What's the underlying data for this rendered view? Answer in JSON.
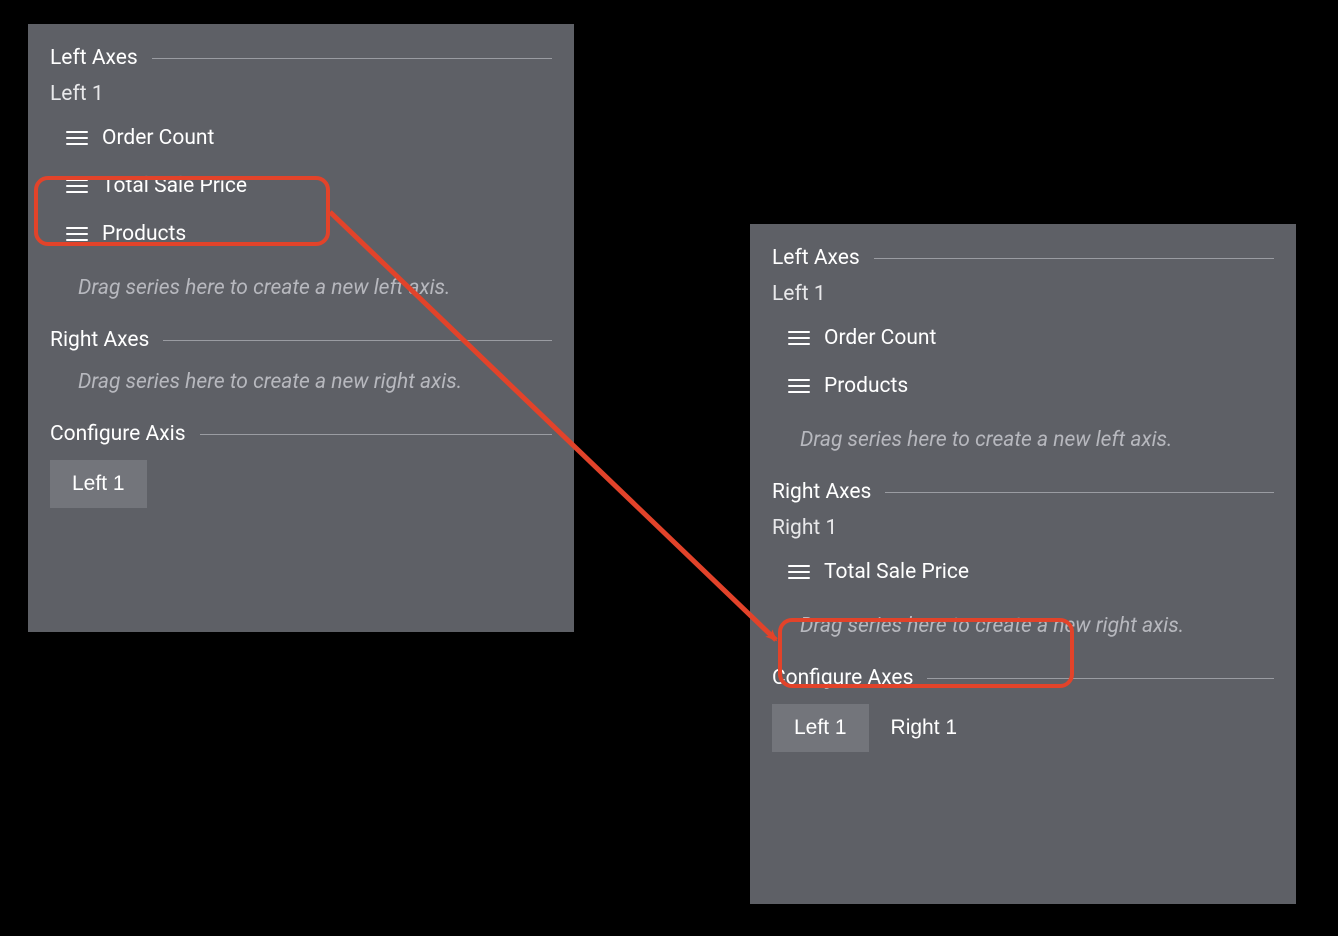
{
  "annotation_color": "#e2432a",
  "panel_a": {
    "left_axes": {
      "header": "Left Axes",
      "axes": [
        {
          "name": "Left 1",
          "series": [
            {
              "label": "Order Count"
            },
            {
              "label": "Total Sale Price"
            },
            {
              "label": "Products"
            }
          ]
        }
      ],
      "drop_hint": "Drag series here to create a new left axis."
    },
    "right_axes": {
      "header": "Right Axes",
      "drop_hint": "Drag series here to create a new right axis."
    },
    "configure": {
      "header": "Configure Axis",
      "tabs": [
        {
          "label": "Left 1",
          "active": true
        }
      ]
    }
  },
  "panel_b": {
    "left_axes": {
      "header": "Left Axes",
      "axes": [
        {
          "name": "Left 1",
          "series": [
            {
              "label": "Order Count"
            },
            {
              "label": "Products"
            }
          ]
        }
      ],
      "drop_hint": "Drag series here to create a new left axis."
    },
    "right_axes": {
      "header": "Right Axes",
      "axes": [
        {
          "name": "Right 1",
          "series": [
            {
              "label": "Total Sale Price"
            }
          ]
        }
      ],
      "drop_hint": "Drag series here to create a new right axis."
    },
    "configure": {
      "header": "Configure Axes",
      "tabs": [
        {
          "label": "Left 1",
          "active": true
        },
        {
          "label": "Right 1",
          "active": false
        }
      ]
    }
  }
}
